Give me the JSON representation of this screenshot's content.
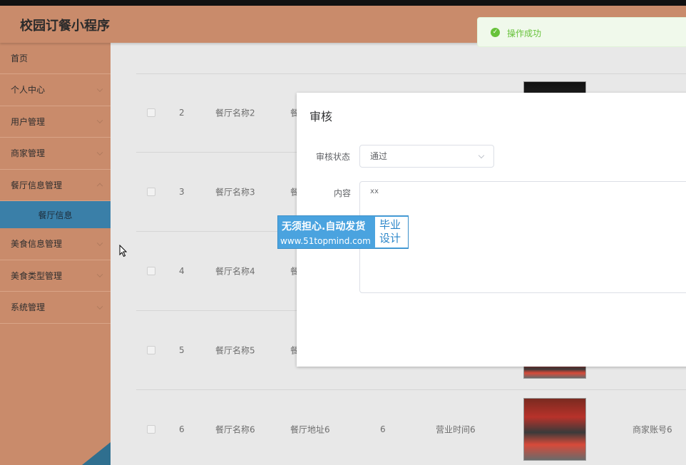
{
  "app": {
    "title": "校园订餐小程序"
  },
  "sidebar": {
    "items": [
      {
        "label": "首页",
        "has_children": false
      },
      {
        "label": "个人中心",
        "has_children": true
      },
      {
        "label": "用户管理",
        "has_children": true
      },
      {
        "label": "商家管理",
        "has_children": true
      },
      {
        "label": "餐厅信息管理",
        "has_children": true
      },
      {
        "label": "餐厅信息",
        "has_children": false,
        "active": true
      },
      {
        "label": "美食信息管理",
        "has_children": true
      },
      {
        "label": "美食类型管理",
        "has_children": true
      },
      {
        "label": "系统管理",
        "has_children": true
      }
    ]
  },
  "table": {
    "rows": [
      {
        "index": "2",
        "name": "餐厅名称2",
        "address": "餐"
      },
      {
        "index": "3",
        "name": "餐厅名称3",
        "address": "餐"
      },
      {
        "index": "4",
        "name": "餐厅名称4",
        "address": "餐"
      },
      {
        "index": "5",
        "name": "餐厅名称5",
        "address": "餐"
      },
      {
        "index": "6",
        "name": "餐厅名称6",
        "address": "餐厅地址6",
        "value": "6",
        "hours": "营业时间6",
        "account": "商家账号6"
      }
    ]
  },
  "dialog": {
    "title": "审核",
    "status_label": "审核状态",
    "status_value": "通过",
    "content_label": "内容",
    "content_value": "xx"
  },
  "watermark": {
    "line1": "无须担心.自动发货",
    "line2": "www.51topmind.com",
    "badge_line1": "毕业",
    "badge_line2": "设计"
  },
  "toast": {
    "message": "操作成功"
  },
  "colors": {
    "sidebar_bg": "#c98b6b",
    "active_item": "#3a7fa8",
    "success": "#67c23a",
    "watermark": "#4aa3df"
  }
}
